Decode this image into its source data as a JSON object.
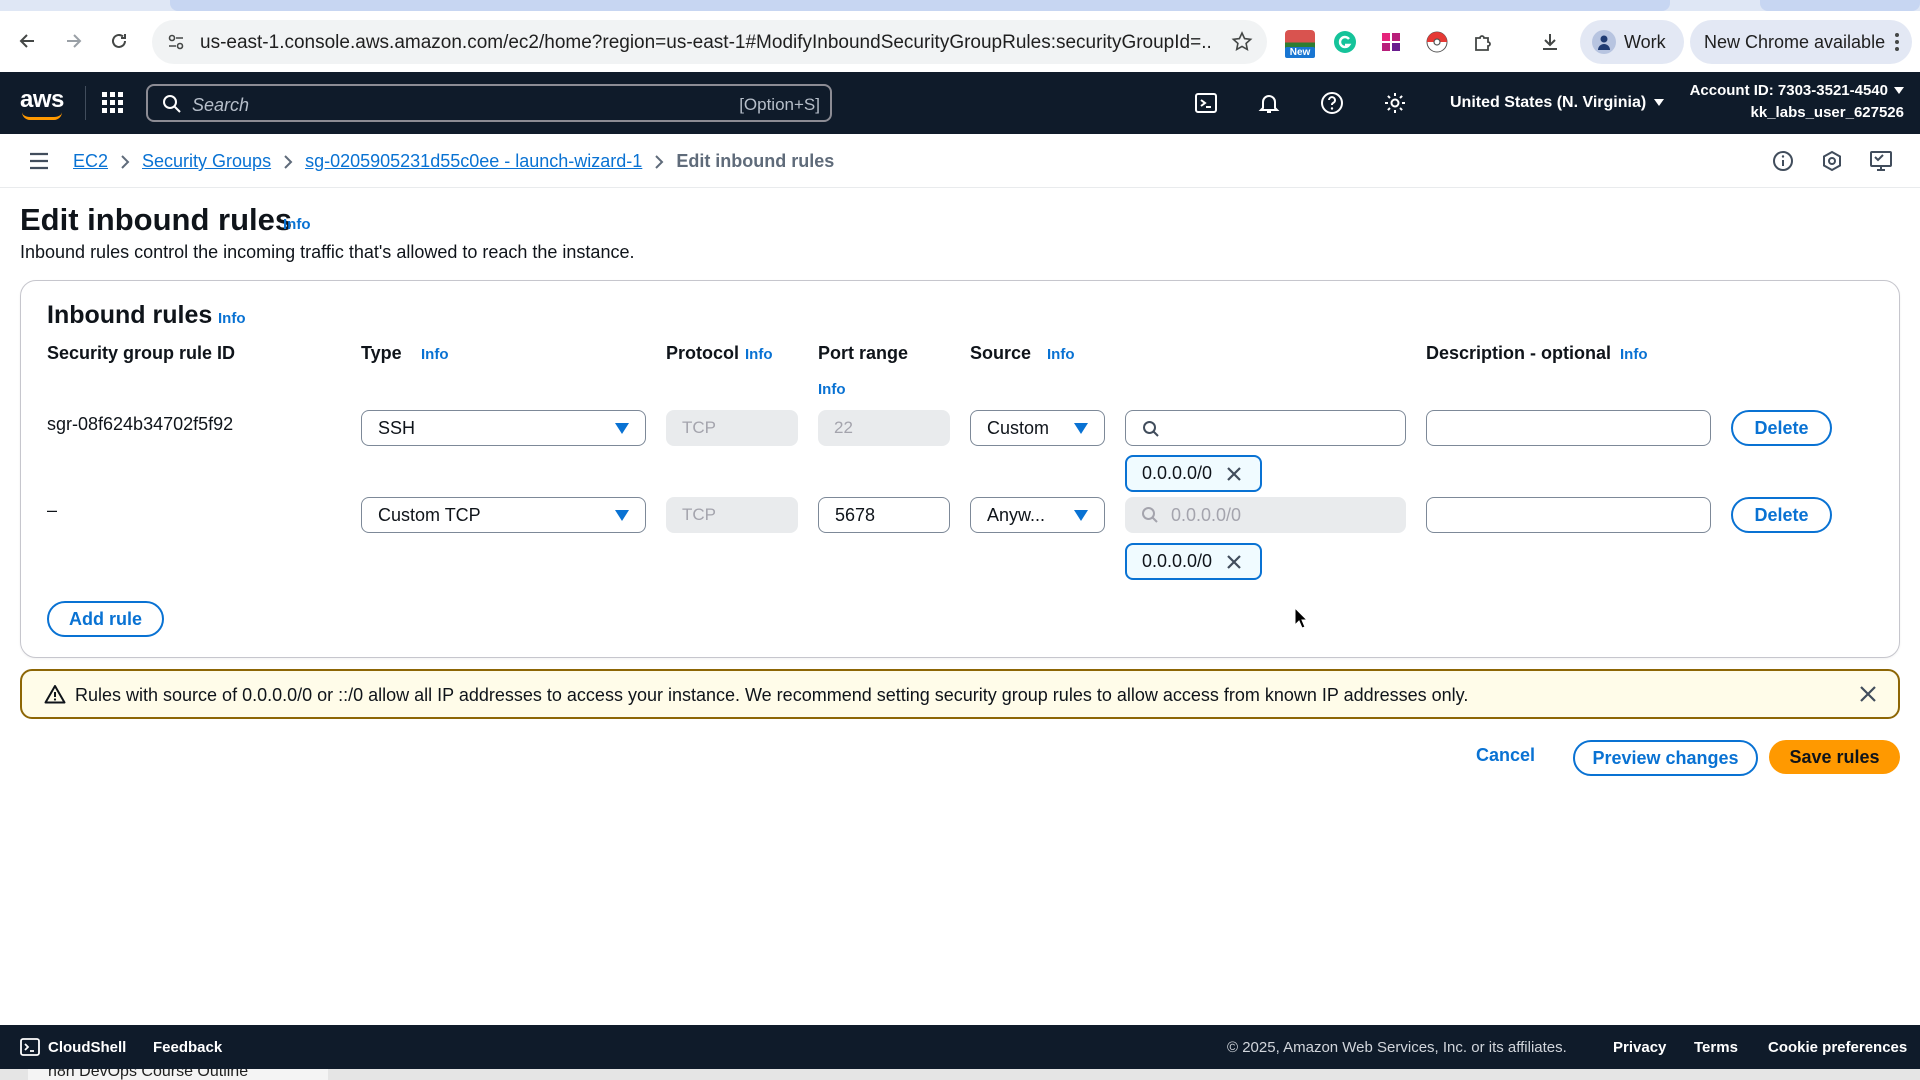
{
  "browser": {
    "url": "us-east-1.console.aws.amazon.com/ec2/home?region=us-east-1#ModifyInboundSecurityGroupRules:securityGroupId=...",
    "profile_label": "Work",
    "update_label": "New Chrome available",
    "ext_badge_label": "New",
    "bottom_tab_label": "n8n DevOps Course Outline"
  },
  "aws_nav": {
    "logo": "aws",
    "search_placeholder": "Search",
    "search_shortcut": "[Option+S]",
    "region": "United States (N. Virginia)",
    "account_id": "Account ID: 7303-3521-4540",
    "username": "kk_labs_user_627526"
  },
  "breadcrumb": {
    "items": [
      "EC2",
      "Security Groups",
      "sg-0205905231d55c0ee - launch-wizard-1"
    ],
    "current": "Edit inbound rules"
  },
  "page": {
    "title": "Edit inbound rules",
    "info": "Info",
    "description": "Inbound rules control the incoming traffic that's allowed to reach the instance."
  },
  "panel": {
    "title": "Inbound rules",
    "info": "Info",
    "columns": {
      "rule_id": "Security group rule ID",
      "type": "Type",
      "protocol": "Protocol",
      "port_range": "Port range",
      "source": "Source",
      "description": "Description - optional"
    },
    "rules": [
      {
        "rule_id": "sgr-08f624b34702f5f92",
        "type": "SSH",
        "protocol": "TCP",
        "port_range": "22",
        "source_type": "Custom",
        "source_search": "",
        "token": "0.0.0.0/0",
        "description": "",
        "delete_label": "Delete"
      },
      {
        "rule_id": "–",
        "type": "Custom TCP",
        "protocol": "TCP",
        "port_range": "5678",
        "source_type": "Anyw...",
        "source_search": "0.0.0.0/0",
        "token": "0.0.0.0/0",
        "description": "",
        "delete_label": "Delete"
      }
    ],
    "add_rule_label": "Add rule"
  },
  "alert": {
    "message": "Rules with source of 0.0.0.0/0 or ::/0 allow all IP addresses to access your instance. We recommend setting security group rules to allow access from known IP addresses only."
  },
  "actions": {
    "cancel": "Cancel",
    "preview": "Preview changes",
    "save": "Save rules"
  },
  "footer": {
    "cloudshell": "CloudShell",
    "feedback": "Feedback",
    "copyright": "© 2025, Amazon Web Services, Inc. or its affiliates.",
    "privacy": "Privacy",
    "terms": "Terms",
    "cookies": "Cookie preferences"
  },
  "colors": {
    "aws_nav_bg": "#0f1b2a",
    "link_blue": "#0972d3",
    "primary_orange": "#ff9900",
    "warning_border": "#8d6605"
  }
}
